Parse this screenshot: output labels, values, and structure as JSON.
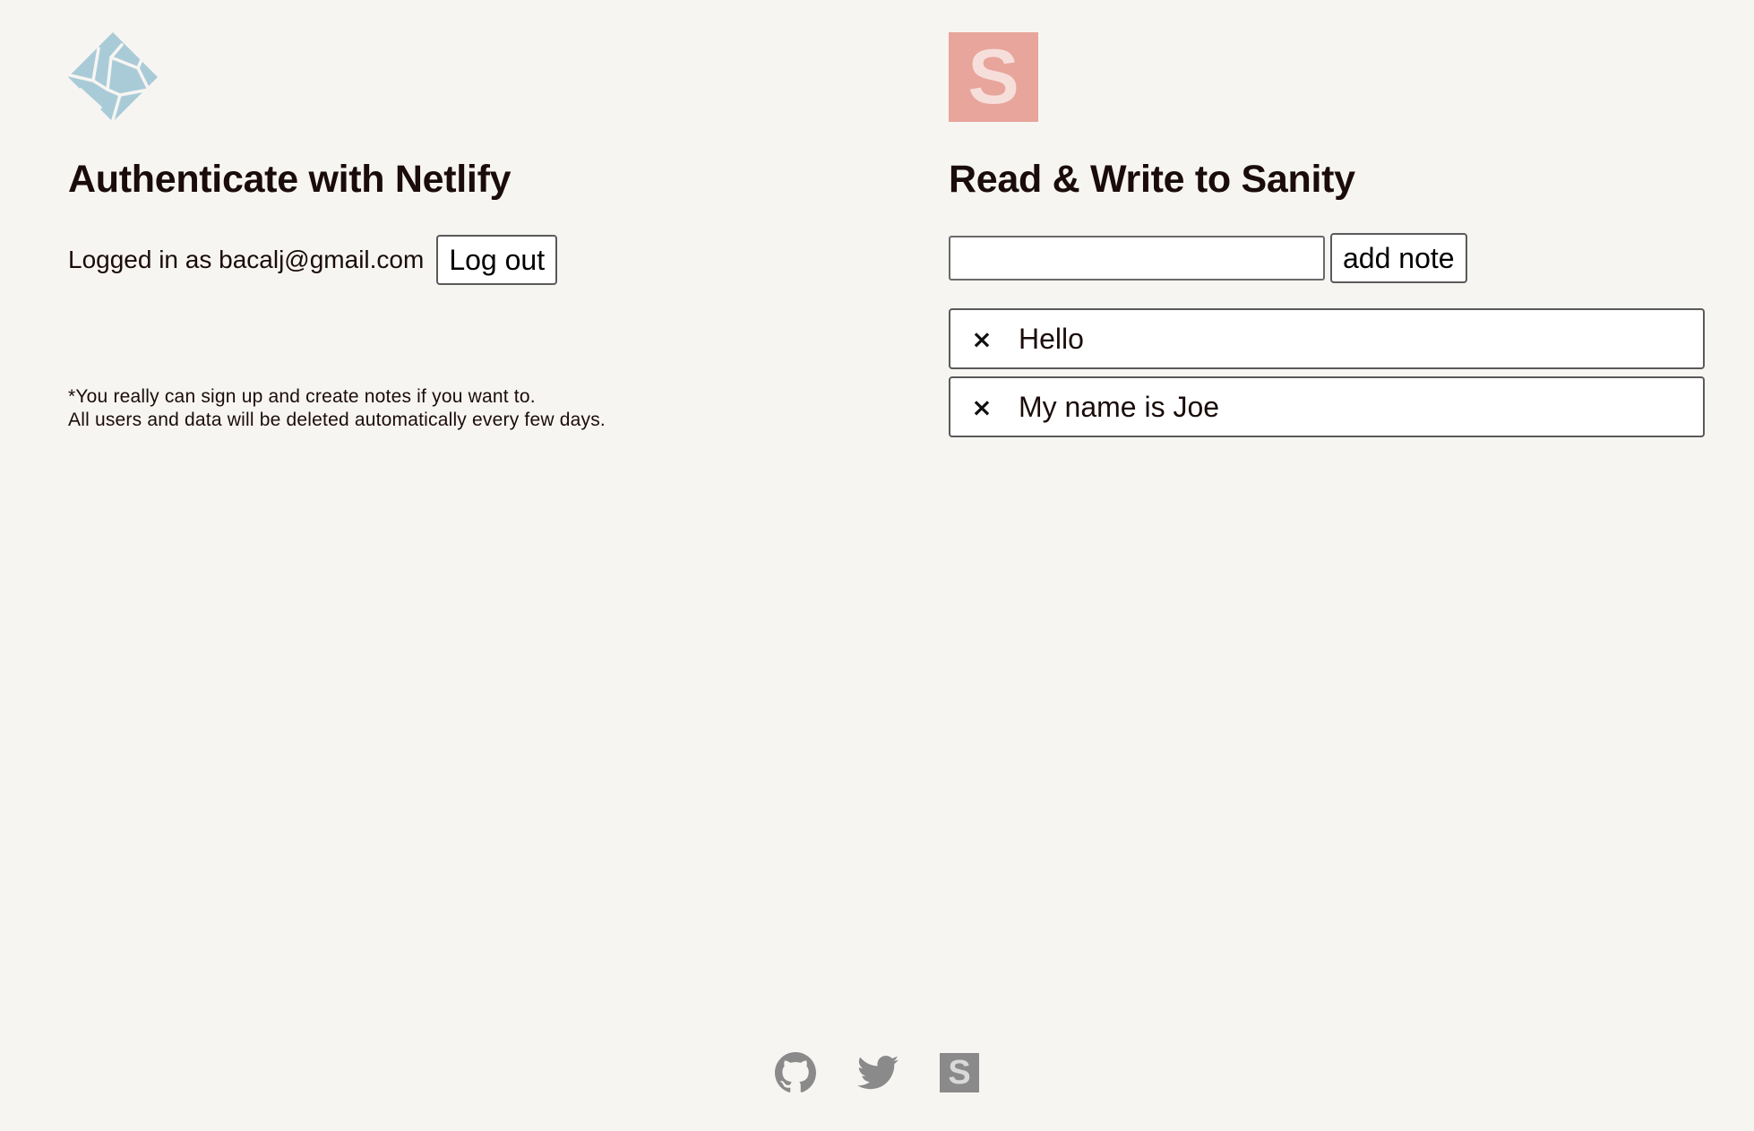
{
  "netlify": {
    "logo_icon": "netlify-logo-icon",
    "heading": "Authenticate with Netlify",
    "login_text": "Logged in as bacalj@gmail.com",
    "logout_label": "Log out",
    "footnote_line1": "*You really can sign up and create notes if you want to.",
    "footnote_line2": "All users and data will be deleted automatically every few days."
  },
  "sanity": {
    "logo_icon": "sanity-logo-icon",
    "logo_letter": "S",
    "heading": "Read & Write to Sanity",
    "input_value": "",
    "add_label": "add note",
    "delete_symbol": "×",
    "notes": [
      {
        "text": "Hello"
      },
      {
        "text": "My name is Joe"
      }
    ]
  },
  "footer": {
    "icons": [
      "github-icon",
      "twitter-icon",
      "sanity-icon"
    ],
    "sanity_letter": "S"
  },
  "colors": {
    "background": "#f7f5f2",
    "text": "#1a0c0a",
    "netlify_teal": "#a9cbd8",
    "sanity_red": "#e8a59b",
    "footer_gray": "#8a8a8a"
  }
}
